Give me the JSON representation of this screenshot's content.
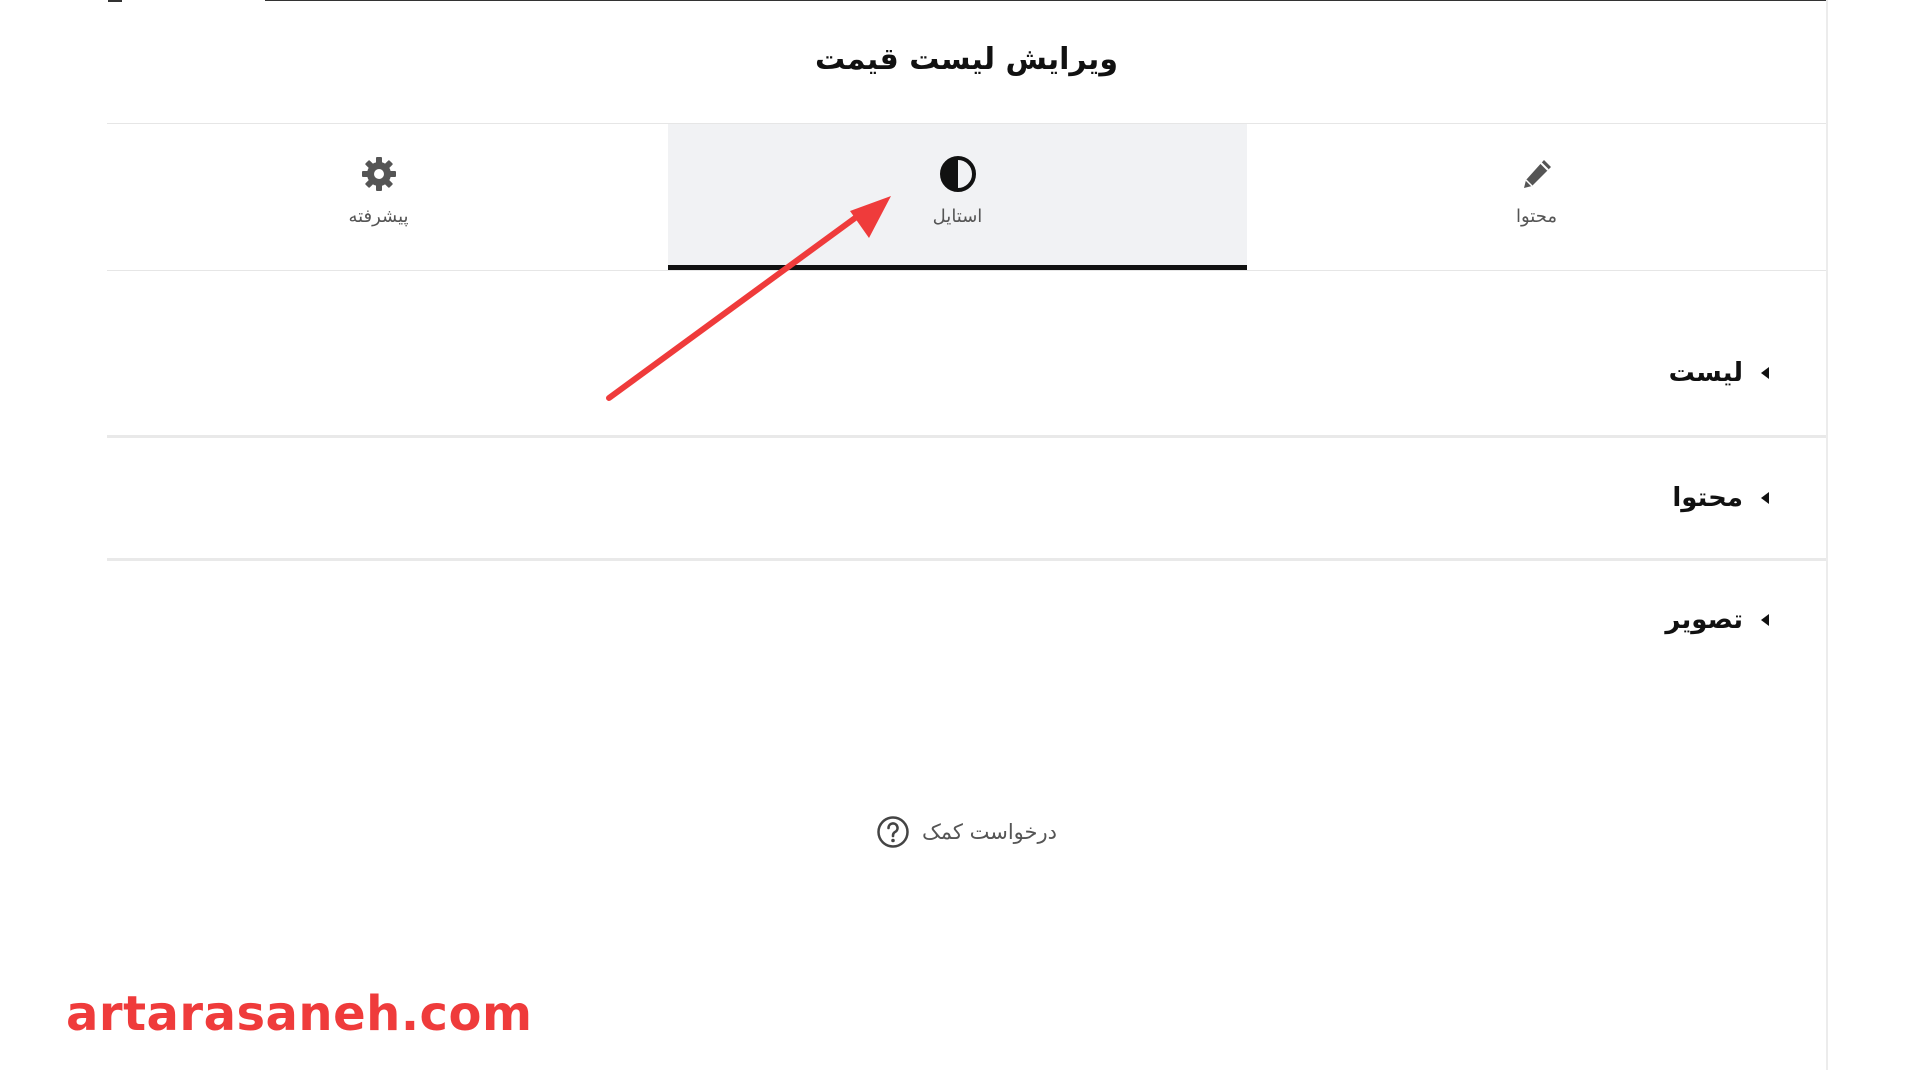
{
  "panel": {
    "title": "ویرایش لیست قیمت"
  },
  "tabs": [
    {
      "label": "محتوا",
      "icon": "pencil-icon",
      "active": false
    },
    {
      "label": "استایل",
      "icon": "contrast-icon",
      "active": true
    },
    {
      "label": "پیشرفته",
      "icon": "gear-icon",
      "active": false
    }
  ],
  "sections": [
    {
      "title": "لیست",
      "icon": "caret-left-icon"
    },
    {
      "title": "محتوا",
      "icon": "caret-left-icon"
    },
    {
      "title": "تصویر",
      "icon": "caret-left-icon"
    }
  ],
  "help": {
    "label": "درخواست کمک",
    "icon": "question-circle-icon"
  },
  "annotation": {
    "color": "#ef3b3b"
  },
  "watermark": {
    "text": "artarasaneh.com"
  },
  "colors": {
    "active_tab_bg": "#f1f2f4",
    "active_tab_underline": "#111111",
    "icon": "#555555"
  }
}
